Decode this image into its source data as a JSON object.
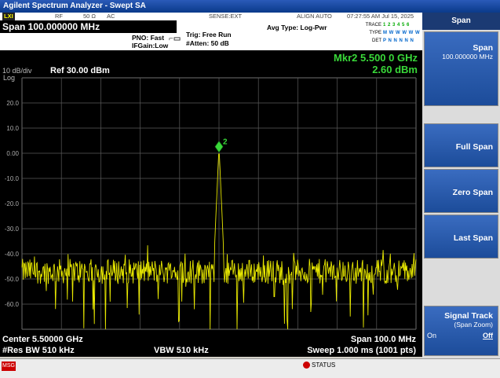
{
  "window": {
    "title": "Agilent Spectrum Analyzer - Swept SA"
  },
  "status_row": {
    "rf": "RF",
    "impedance": "50 Ω",
    "coupling": "AC",
    "sense": "SENSE:EXT",
    "align": "ALIGN AUTO",
    "datetime": "07:27:55 AM Jul 15, 2025"
  },
  "header": {
    "span_display": "Span 100.000000 MHz",
    "pno": "PNO: Fast",
    "ifgain": "IFGain:Low",
    "trig": "Trig: Free Run",
    "atten": "#Atten: 50 dB",
    "avg_type": "Avg Type: Log-Pwr",
    "trace_label": "TRACE",
    "trace_value": "1 2 3 4 5 6",
    "type_label": "TYPE",
    "type_value": "M W W W W W",
    "det_label": "DET",
    "det_value": "P N N N N N"
  },
  "display": {
    "scale": "10 dB/div",
    "ref_level": "Ref 30.00 dBm",
    "log_label": "Log",
    "marker_freq": "Mkr2 5.500 0 GHz",
    "marker_amp": "2.60 dBm",
    "marker_label": "2",
    "y_tick_labels": [
      "20.0",
      "10.0",
      "0.00",
      "-10.0",
      "-20.0",
      "-30.0",
      "-40.0",
      "-50.0",
      "-60.0"
    ],
    "center": "Center 5.50000 GHz",
    "span": "Span 100.0 MHz",
    "res_bw": "#Res BW 510 kHz",
    "vbw": "VBW 510 kHz",
    "sweep": "Sweep  1.000 ms (1001 pts)"
  },
  "chart_data": {
    "type": "line",
    "y_unit": "dBm",
    "ylim": [
      -70,
      30
    ],
    "x_range_ghz": [
      5.45,
      5.55
    ],
    "grid": true,
    "noise_floor_dbm": -47,
    "peak": {
      "freq_ghz": 5.5,
      "level_dbm": 2.6
    }
  },
  "softkeys": {
    "title": "Span",
    "span_main": "Span",
    "span_sub": "100.000000 MHz",
    "full_span": "Full Span",
    "zero_span": "Zero Span",
    "last_span": "Last Span",
    "signal_track_main": "Signal Track",
    "signal_track_sub": "(Span Zoom)",
    "on": "On",
    "off": "Off"
  },
  "bottom": {
    "msg": "MSG",
    "status": "STATUS"
  },
  "colors": {
    "trace": "#e8e800",
    "marker": "#39d839",
    "grid": "#5a5a5a"
  }
}
